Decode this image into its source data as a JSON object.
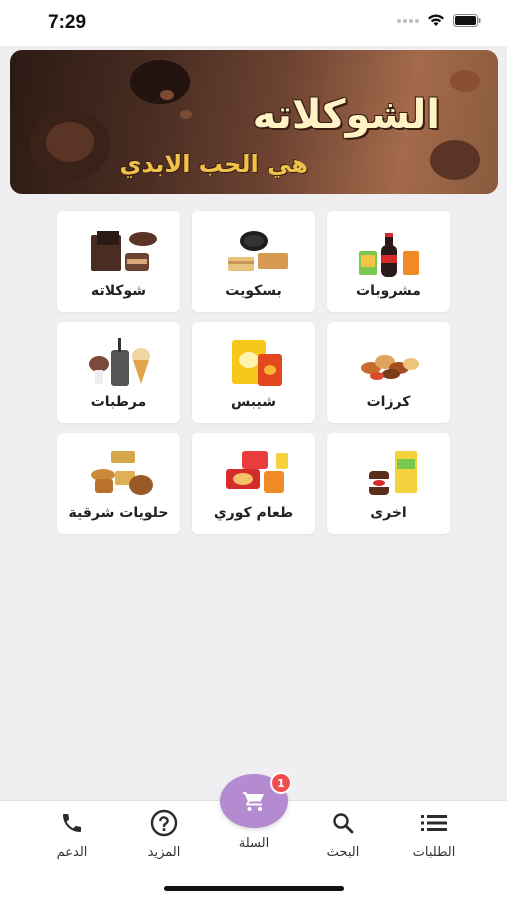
{
  "status_bar": {
    "time": "7:29",
    "icons": [
      "signal-icon",
      "wifi-icon",
      "battery-icon"
    ]
  },
  "banner": {
    "title": "الشوكلاته",
    "subtitle": "هي الحب الابدي",
    "colors": {
      "dark": "#2b1a14",
      "light": "#a36a4b",
      "title": "#fff3c6",
      "subtitle": "#f0c24a"
    }
  },
  "categories": [
    {
      "label": "مشروبات",
      "icon": "drinks-icon"
    },
    {
      "label": "بسكويت",
      "icon": "biscuits-icon"
    },
    {
      "label": "شوكلاته",
      "icon": "chocolate-icon"
    },
    {
      "label": "كرزات",
      "icon": "nuts-icon"
    },
    {
      "label": "شيبس",
      "icon": "chips-icon"
    },
    {
      "label": "مرطبات",
      "icon": "ice-cream-icon"
    },
    {
      "label": "اخرى",
      "icon": "other-food-icon"
    },
    {
      "label": "طعام كوري",
      "icon": "korean-food-icon"
    },
    {
      "label": "حلويات شرقية",
      "icon": "oriental-sweets-icon"
    }
  ],
  "bottom_nav": {
    "orders": {
      "label": "الطلبات",
      "icon": "list-icon"
    },
    "search": {
      "label": "البحث",
      "icon": "search-icon"
    },
    "cart": {
      "label": "السلة",
      "icon": "cart-icon",
      "badge": "1",
      "color": "#b48bd0"
    },
    "more": {
      "label": "المزيد",
      "icon": "help-icon"
    },
    "support": {
      "label": "الدعم",
      "icon": "phone-icon"
    }
  }
}
